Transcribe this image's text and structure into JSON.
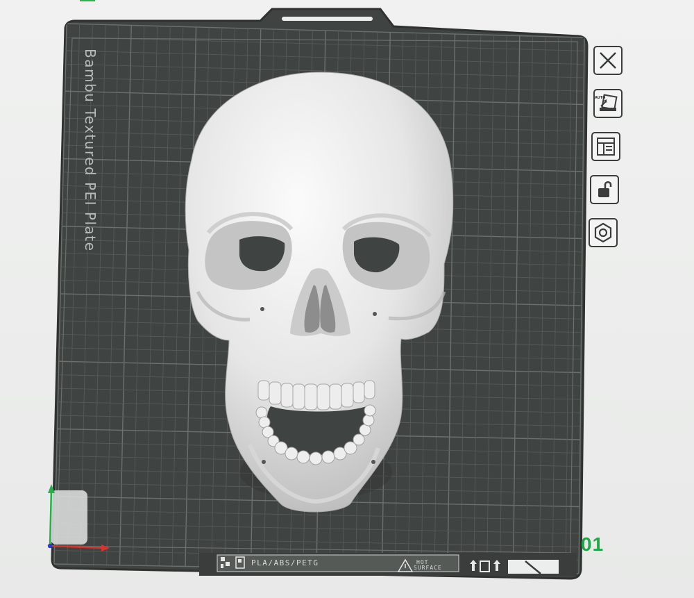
{
  "viewport": {
    "plate_name": "Bambu Textured PEI Plate",
    "plate_number": "01",
    "model": "skull"
  },
  "bottom_strip": {
    "filament_types": "PLA/ABS/PETG",
    "hot_surface_line1": "HOT",
    "hot_surface_line2": "SURFACE"
  },
  "plate_toolbar": {
    "items": [
      {
        "name": "remove-plate",
        "icon": "close-icon"
      },
      {
        "name": "auto-arrange",
        "icon": "auto-orient-icon",
        "badge": "AUTO"
      },
      {
        "name": "plate-settings",
        "icon": "layout-icon"
      },
      {
        "name": "lock-plate",
        "icon": "unlock-icon"
      },
      {
        "name": "plate-settings-gear",
        "icon": "hex-nut-icon"
      }
    ]
  },
  "colors": {
    "accent": "#1fa845",
    "bed": "#3f4341",
    "grid": "#5b605d",
    "bed_border": "#2f3230",
    "axis_x": "#d9322c",
    "axis_y": "#27b04a",
    "axis_z": "#2a3bd6"
  }
}
